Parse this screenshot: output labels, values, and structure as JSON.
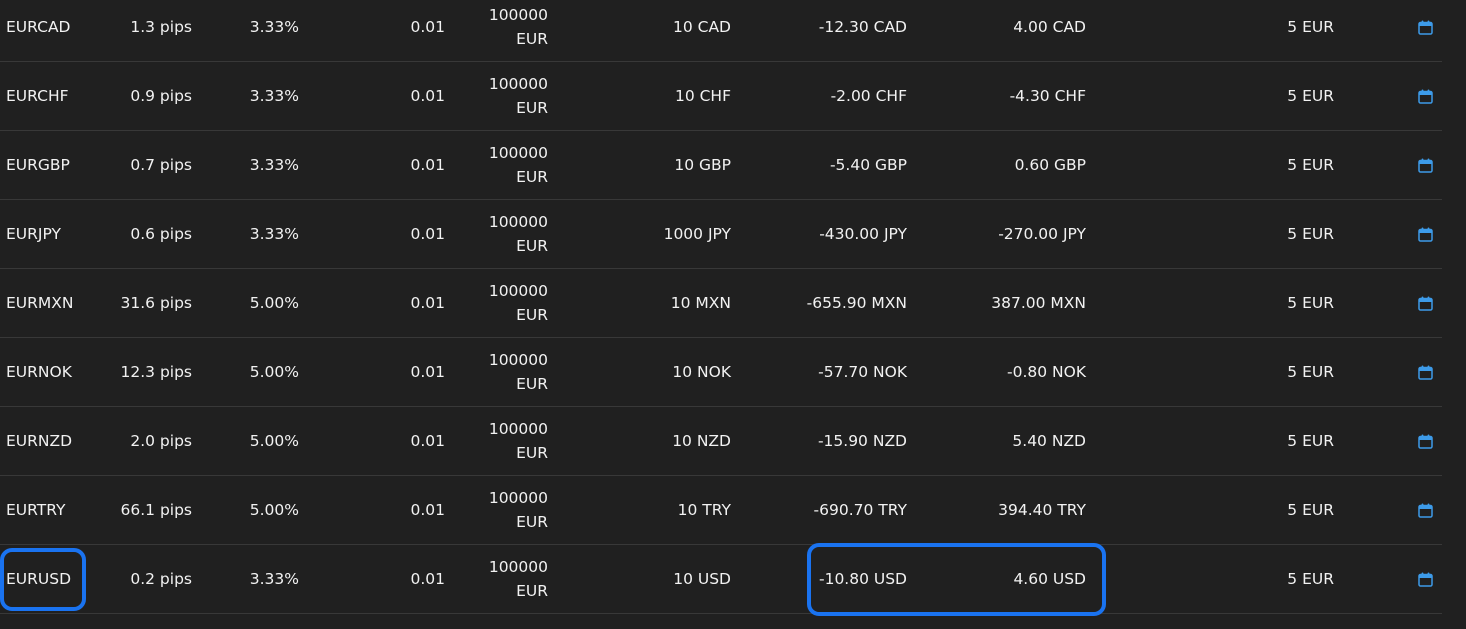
{
  "rows": [
    {
      "symbol": "EURCAD",
      "spread": "1.3 pips",
      "margin": "3.33%",
      "min_lot": "0.01",
      "size_value": "100000",
      "size_unit": "EUR",
      "pip_value": "10 CAD",
      "swap_long": "-12.30 CAD",
      "swap_short": "4.00 CAD",
      "commission": "5 EUR"
    },
    {
      "symbol": "EURCHF",
      "spread": "0.9 pips",
      "margin": "3.33%",
      "min_lot": "0.01",
      "size_value": "100000",
      "size_unit": "EUR",
      "pip_value": "10 CHF",
      "swap_long": "-2.00 CHF",
      "swap_short": "-4.30 CHF",
      "commission": "5 EUR"
    },
    {
      "symbol": "EURGBP",
      "spread": "0.7 pips",
      "margin": "3.33%",
      "min_lot": "0.01",
      "size_value": "100000",
      "size_unit": "EUR",
      "pip_value": "10 GBP",
      "swap_long": "-5.40 GBP",
      "swap_short": "0.60 GBP",
      "commission": "5 EUR"
    },
    {
      "symbol": "EURJPY",
      "spread": "0.6 pips",
      "margin": "3.33%",
      "min_lot": "0.01",
      "size_value": "100000",
      "size_unit": "EUR",
      "pip_value": "1000 JPY",
      "swap_long": "-430.00 JPY",
      "swap_short": "-270.00 JPY",
      "commission": "5 EUR"
    },
    {
      "symbol": "EURMXN",
      "spread": "31.6 pips",
      "margin": "5.00%",
      "min_lot": "0.01",
      "size_value": "100000",
      "size_unit": "EUR",
      "pip_value": "10 MXN",
      "swap_long": "-655.90 MXN",
      "swap_short": "387.00 MXN",
      "commission": "5 EUR"
    },
    {
      "symbol": "EURNOK",
      "spread": "12.3 pips",
      "margin": "5.00%",
      "min_lot": "0.01",
      "size_value": "100000",
      "size_unit": "EUR",
      "pip_value": "10 NOK",
      "swap_long": "-57.70 NOK",
      "swap_short": "-0.80 NOK",
      "commission": "5 EUR"
    },
    {
      "symbol": "EURNZD",
      "spread": "2.0 pips",
      "margin": "5.00%",
      "min_lot": "0.01",
      "size_value": "100000",
      "size_unit": "EUR",
      "pip_value": "10 NZD",
      "swap_long": "-15.90 NZD",
      "swap_short": "5.40 NZD",
      "commission": "5 EUR"
    },
    {
      "symbol": "EURTRY",
      "spread": "66.1 pips",
      "margin": "5.00%",
      "min_lot": "0.01",
      "size_value": "100000",
      "size_unit": "EUR",
      "pip_value": "10 TRY",
      "swap_long": "-690.70 TRY",
      "swap_short": "394.40 TRY",
      "commission": "5 EUR"
    },
    {
      "symbol": "EURUSD",
      "spread": "0.2 pips",
      "margin": "3.33%",
      "min_lot": "0.01",
      "size_value": "100000",
      "size_unit": "EUR",
      "pip_value": "10 USD",
      "swap_long": "-10.80 USD",
      "swap_short": "4.60 USD",
      "commission": "5 EUR"
    }
  ],
  "icons": {
    "calendar": "calendar-icon"
  },
  "colors": {
    "background": "#202020",
    "text": "#f2f2f2",
    "row_divider": "#383838",
    "icon_accent": "#3d9be9",
    "highlight": "#1a73f0"
  }
}
